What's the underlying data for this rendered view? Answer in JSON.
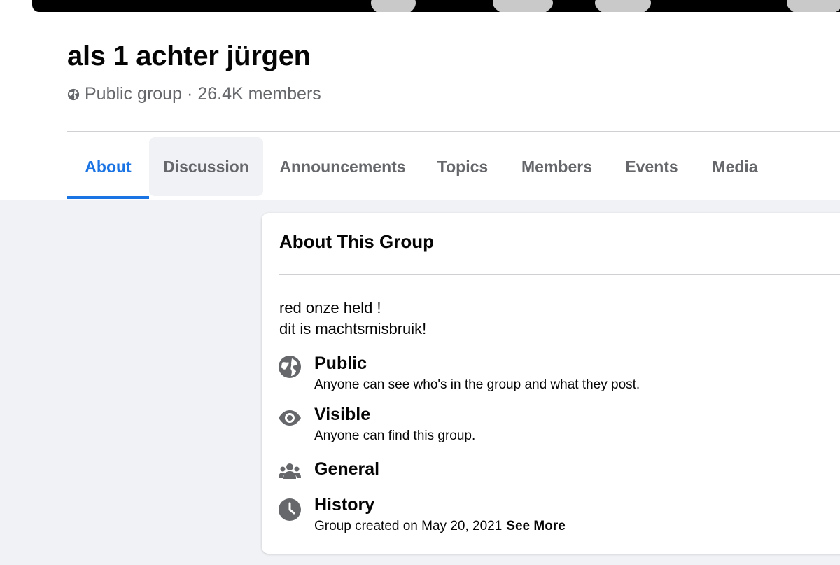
{
  "group": {
    "name": "als 1 achter jürgen",
    "privacy": "Public group",
    "separator": "·",
    "members": "26.4K members"
  },
  "tabs": [
    {
      "label": "About",
      "active": true
    },
    {
      "label": "Discussion",
      "active": false
    },
    {
      "label": "Announcements",
      "active": false
    },
    {
      "label": "Topics",
      "active": false
    },
    {
      "label": "Members",
      "active": false
    },
    {
      "label": "Events",
      "active": false
    },
    {
      "label": "Media",
      "active": false
    }
  ],
  "about": {
    "title": "About This Group",
    "description": [
      "red onze held !",
      "dit is machtsmisbruik!"
    ],
    "items": [
      {
        "icon": "globe-icon",
        "title": "Public",
        "subtitle": "Anyone can see who's in the group and what they post."
      },
      {
        "icon": "eye-icon",
        "title": "Visible",
        "subtitle": "Anyone can find this group."
      },
      {
        "icon": "people-icon",
        "title": "General",
        "subtitle": ""
      },
      {
        "icon": "clock-icon",
        "title": "History",
        "subtitle": "Group created on May 20, 2021",
        "link": "See More"
      }
    ]
  },
  "colors": {
    "accent": "#1b74e4",
    "icon_gray": "#65676b",
    "page_bg": "#f0f2f5"
  }
}
